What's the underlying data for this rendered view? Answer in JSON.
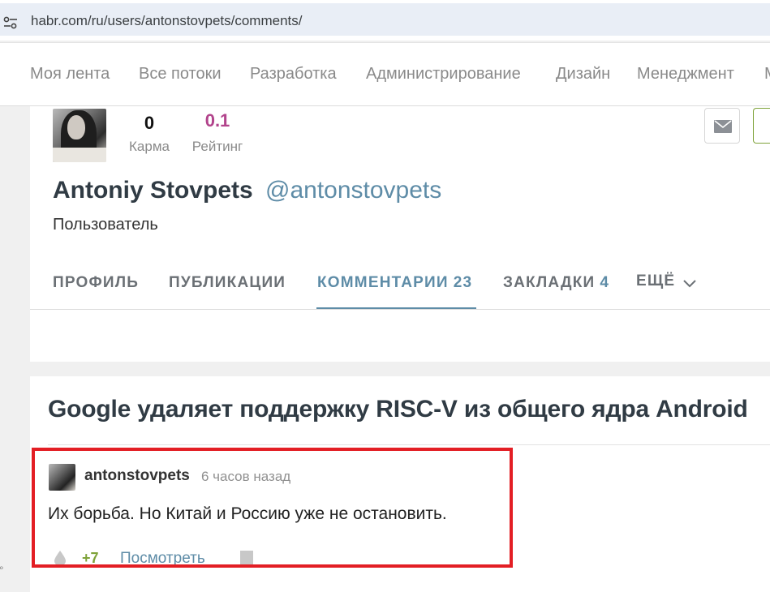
{
  "browser": {
    "url": "habr.com/ru/users/antonstovpets/comments/"
  },
  "topnav": {
    "items": [
      "Моя лента",
      "Все потоки",
      "Разработка",
      "Администрирование",
      "Дизайн",
      "Менеджмент",
      "М"
    ]
  },
  "profile": {
    "karma_value": "0",
    "karma_label": "Карма",
    "rating_value": "0.1",
    "rating_label": "Рейтинг",
    "full_name": "Antoniy Stovpets",
    "handle": "@antonstovpets",
    "role": "Пользователь",
    "tabs": [
      {
        "label": "ПРОФИЛЬ",
        "count": ""
      },
      {
        "label": "ПУБЛИКАЦИИ",
        "count": ""
      },
      {
        "label": "КОММЕНТАРИИ",
        "count": "23"
      },
      {
        "label": "ЗАКЛАДКИ",
        "count": "4"
      },
      {
        "label": "ЕЩЁ",
        "count": ""
      }
    ]
  },
  "comments": {
    "article_title": "Google удаляет поддержку RISC-V из общего ядра Android",
    "items": [
      {
        "author": "antonstovpets",
        "time": "6 часов назад",
        "text": "Их борьба. Но Китай и Россию уже не остановить.",
        "score": "+7",
        "view_link": "Посмотреть"
      }
    ]
  },
  "colors": {
    "accent": "#5e8ca7",
    "rating": "#b2448c",
    "positive": "#7fa33a",
    "highlight": "#e31e24"
  },
  "icons": [
    "site-settings-icon",
    "mail-icon",
    "chevron-down-icon",
    "drop-icon",
    "bookmark-icon"
  ]
}
